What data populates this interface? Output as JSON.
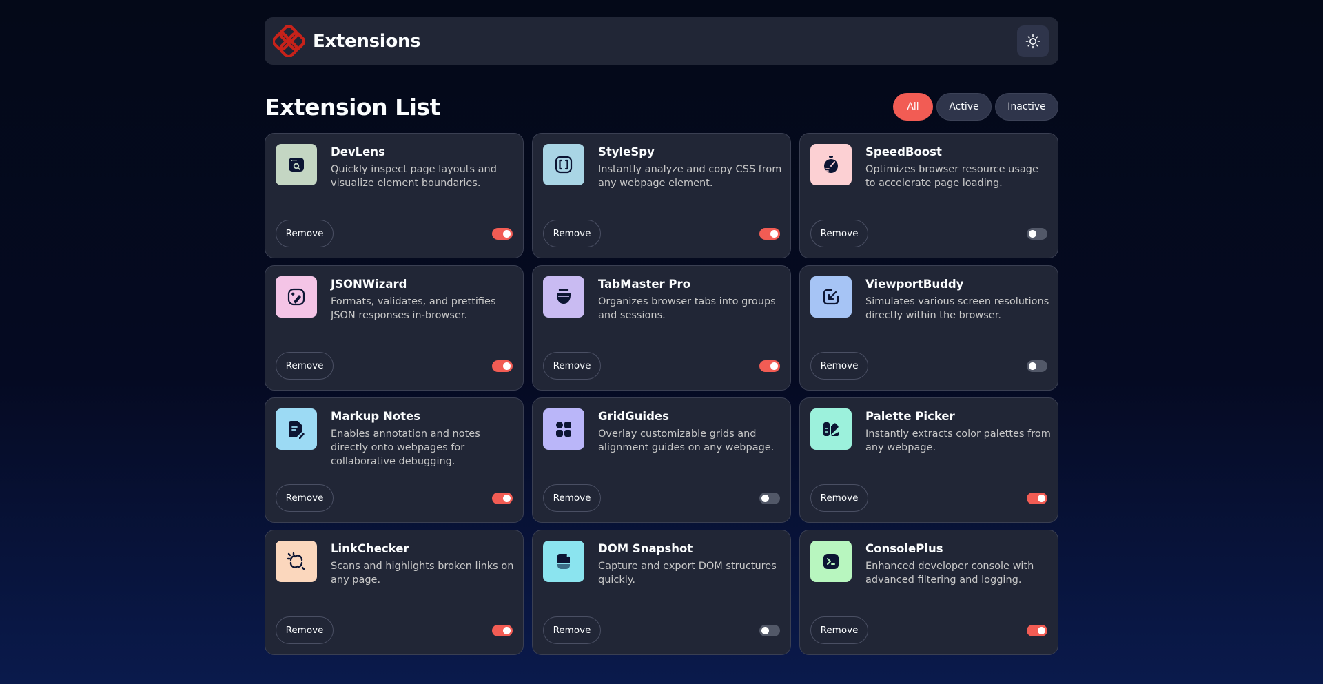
{
  "header": {
    "brand": "Extensions",
    "logo_icon": "logo-icon",
    "theme_icon": "sun-icon"
  },
  "list": {
    "title": "Extension List",
    "filters": [
      {
        "label": "All",
        "active": true
      },
      {
        "label": "Active",
        "active": false
      },
      {
        "label": "Inactive",
        "active": false
      }
    ]
  },
  "colors": {
    "accent": "#f25c54",
    "card_bg": "#212636",
    "toggle_off": "#525868"
  },
  "extensions": [
    {
      "name": "DevLens",
      "description": "Quickly inspect page layouts and visualize element boundaries.",
      "enabled": true,
      "icon": "devlens-icon",
      "icon_bg": "#c4d6c3",
      "remove_label": "Remove"
    },
    {
      "name": "StyleSpy",
      "description": "Instantly analyze and copy CSS from any webpage element.",
      "enabled": true,
      "icon": "stylespy-icon",
      "icon_bg": "#a9d5e5",
      "remove_label": "Remove"
    },
    {
      "name": "SpeedBoost",
      "description": "Optimizes browser resource usage to accelerate page loading.",
      "enabled": false,
      "icon": "speedboost-icon",
      "icon_bg": "#fcd0d3",
      "remove_label": "Remove"
    },
    {
      "name": "JSONWizard",
      "description": "Formats, validates, and prettifies JSON responses in-browser.",
      "enabled": true,
      "icon": "jsonwizard-icon",
      "icon_bg": "#f4c4e6",
      "remove_label": "Remove"
    },
    {
      "name": "TabMaster Pro",
      "description": "Organizes browser tabs into groups and sessions.",
      "enabled": true,
      "icon": "tabmaster-icon",
      "icon_bg": "#c9bbf2",
      "remove_label": "Remove"
    },
    {
      "name": "ViewportBuddy",
      "description": "Simulates various screen resolutions directly within the browser.",
      "enabled": false,
      "icon": "viewportbuddy-icon",
      "icon_bg": "#a6c4f5",
      "remove_label": "Remove"
    },
    {
      "name": "Markup Notes",
      "description": "Enables annotation and notes directly onto webpages for collaborative debugging.",
      "enabled": true,
      "icon": "markupnotes-icon",
      "icon_bg": "#9cdaf4",
      "remove_label": "Remove"
    },
    {
      "name": "GridGuides",
      "description": "Overlay customizable grids and alignment guides on any webpage.",
      "enabled": false,
      "icon": "gridguides-icon",
      "icon_bg": "#bab6f9",
      "remove_label": "Remove"
    },
    {
      "name": "Palette Picker",
      "description": "Instantly extracts color palettes from any webpage.",
      "enabled": true,
      "icon": "palettepicker-icon",
      "icon_bg": "#9cf1dc",
      "remove_label": "Remove"
    },
    {
      "name": "LinkChecker",
      "description": "Scans and highlights broken links on any page.",
      "enabled": true,
      "icon": "linkchecker-icon",
      "icon_bg": "#fbd7bd",
      "remove_label": "Remove"
    },
    {
      "name": "DOM Snapshot",
      "description": "Capture and export DOM structures quickly.",
      "enabled": false,
      "icon": "domsnapshot-icon",
      "icon_bg": "#8be4ef",
      "remove_label": "Remove"
    },
    {
      "name": "ConsolePlus",
      "description": "Enhanced developer console with advanced filtering and logging.",
      "enabled": true,
      "icon": "consoleplus-icon",
      "icon_bg": "#b8f6bf",
      "remove_label": "Remove"
    }
  ]
}
